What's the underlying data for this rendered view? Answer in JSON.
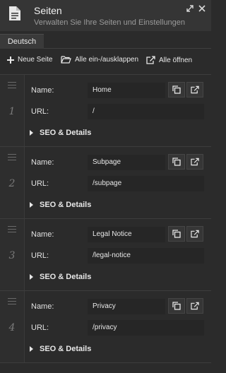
{
  "header": {
    "title": "Seiten",
    "subtitle": "Verwalten Sie Ihre Seiten und Einstellungen",
    "icons": [
      "document-icon",
      "expand-icon",
      "close-icon"
    ]
  },
  "tabs": [
    {
      "label": "Deutsch"
    }
  ],
  "toolbar": {
    "new_page": "Neue Seite",
    "toggle_all": "Alle ein-/ausklappen",
    "open_all": "Alle öffnen"
  },
  "pages": [
    {
      "number": "1",
      "name_label": "Name:",
      "name": "Home",
      "url_label": "URL:",
      "url": "/",
      "details": "SEO & Details"
    },
    {
      "number": "2",
      "name_label": "Name:",
      "name": "Subpage",
      "url_label": "URL:",
      "url": "/subpage",
      "details": "SEO & Details"
    },
    {
      "number": "3",
      "name_label": "Name:",
      "name": "Legal Notice",
      "url_label": "URL:",
      "url": "/legal-notice",
      "details": "SEO & Details"
    },
    {
      "number": "4",
      "name_label": "Name:",
      "name": "Privacy",
      "url_label": "URL:",
      "url": "/privacy",
      "details": "SEO & Details"
    }
  ],
  "colors": {
    "background": "#2b2b2b",
    "header": "#353535",
    "field": "#262626",
    "text": "#e6e6e6"
  }
}
